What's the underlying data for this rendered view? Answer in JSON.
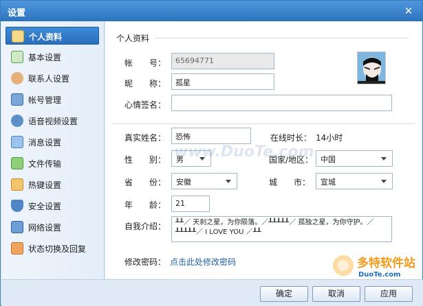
{
  "window": {
    "title": "设置"
  },
  "sidebar": {
    "items": [
      {
        "label": "个人资料",
        "icon": "profile-card-icon",
        "active": true
      },
      {
        "label": "基本设置",
        "icon": "checklist-icon"
      },
      {
        "label": "联系人设置",
        "icon": "contact-icon"
      },
      {
        "label": "帐号管理",
        "icon": "account-icon"
      },
      {
        "label": "语音视频设置",
        "icon": "microphone-icon"
      },
      {
        "label": "消息设置",
        "icon": "message-icon"
      },
      {
        "label": "文件传输",
        "icon": "file-transfer-icon"
      },
      {
        "label": "热键设置",
        "icon": "keyboard-icon"
      },
      {
        "label": "安全设置",
        "icon": "shield-icon"
      },
      {
        "label": "网络设置",
        "icon": "network-icon"
      },
      {
        "label": "状态切换及回复",
        "icon": "status-icon"
      }
    ]
  },
  "profile": {
    "section_title": "个人资料",
    "account_label": "帐　　号：",
    "account_value": "65694771",
    "nickname_label": "昵　　称：",
    "nickname_value": "孤星",
    "signature_label": "心情签名：",
    "signature_value": "",
    "realname_label": "真实姓名：",
    "realname_value": "恐怖",
    "online_label": "在线时长：",
    "online_value": "14小时",
    "gender_label": "性　　别：",
    "gender_value": "男",
    "country_label": "国家/地区：",
    "country_value": "中国",
    "province_label": "省　　份：",
    "province_value": "安徽",
    "city_label": "城　　市：",
    "city_value": "宣城",
    "age_label": "年　　龄：",
    "age_value": "21",
    "intro_label": "自我介绍：",
    "intro_value": "╨╨／ 天刹之星，为你陨落。／┸┸┸┸┸／ 孤独之星，为你守护。／┸┸┸┸┸／   I LOVE YOU   ／┸┸",
    "password_label": "修改密码：",
    "password_link": "点击此处修改密码"
  },
  "footer": {
    "ok": "确定",
    "cancel": "取消",
    "apply": "应用"
  },
  "watermark": {
    "text": "www.DuoTe.com",
    "logo_big": "多特软件站",
    "logo_small": "DuoTe.com"
  }
}
